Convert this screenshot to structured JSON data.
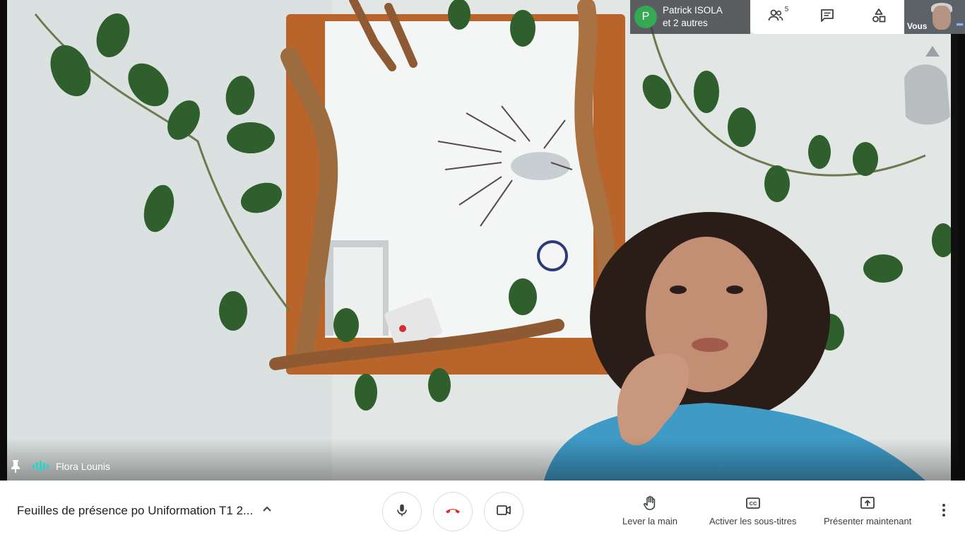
{
  "header": {
    "participant_initial": "P",
    "participant_name": "Patrick ISOLA",
    "participant_others": "et 2 autres",
    "people_count": "5",
    "self_label": "Vous",
    "tools": [
      "people-icon",
      "chat-icon",
      "activities-icon"
    ]
  },
  "speaker": {
    "name": "Flora Lounis",
    "pin_icon": "pin-icon",
    "audio_icon": "audio-level-icon"
  },
  "bottom_bar": {
    "meeting_title": "Feuilles de présence po Uniformation T1 2...",
    "controls": {
      "mic": "microphone-icon",
      "hangup": "hang-up-icon",
      "camera": "camera-icon"
    },
    "actions": {
      "raise_hand": "Lever la main",
      "captions": "Activer les sous-titres",
      "present": "Présenter maintenant"
    }
  },
  "colors": {
    "avatar": "#34a853",
    "hangup": "#d93025",
    "audio": "#2fd3c6",
    "chip_bg": "#3c4043"
  }
}
